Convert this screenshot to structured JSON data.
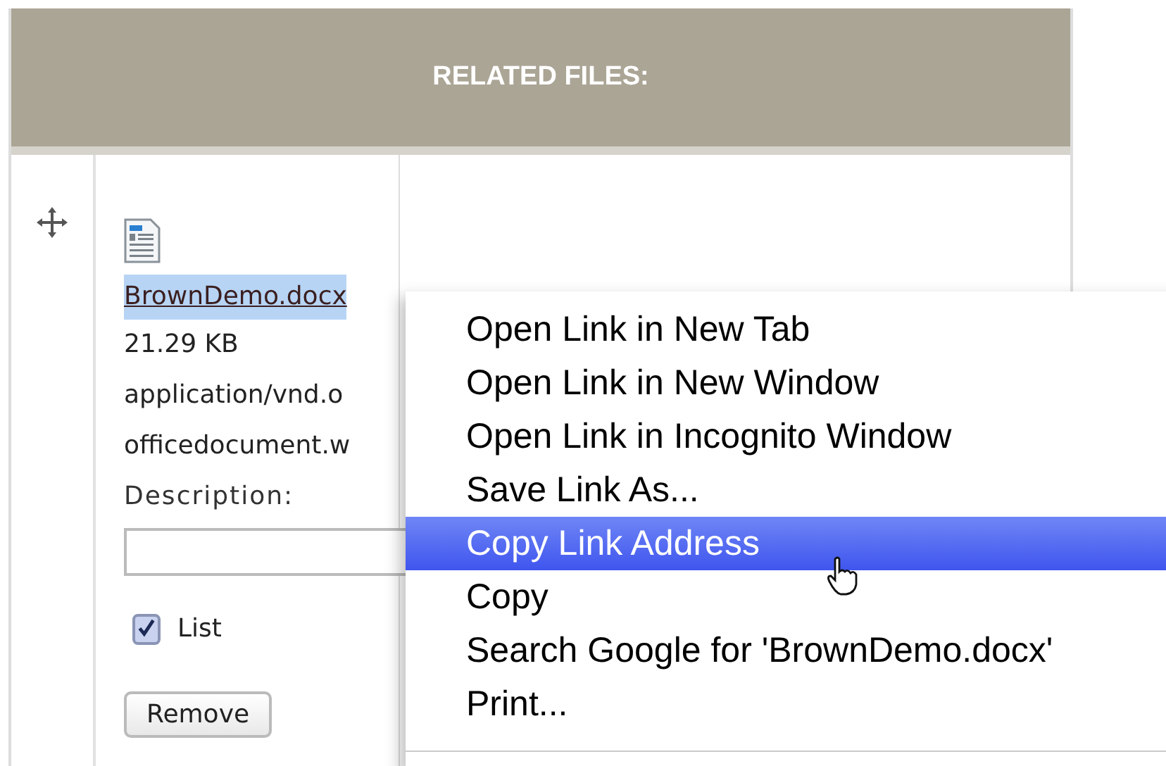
{
  "panel": {
    "title": "RELATED FILES:"
  },
  "file": {
    "name": "BrownDemo.docx",
    "size": "21.29 KB",
    "mime_lines": [
      "application/vnd.o",
      "officedocument.w"
    ],
    "description_label": "Description:",
    "list_checkbox": {
      "label": "List",
      "checked": true
    },
    "remove_button": "Remove"
  },
  "context_menu": {
    "items": [
      {
        "label": "Open Link in New Tab",
        "selected": false
      },
      {
        "label": "Open Link in New Window",
        "selected": false
      },
      {
        "label": "Open Link in Incognito Window",
        "selected": false
      },
      {
        "label": "Save Link As...",
        "selected": false
      },
      {
        "label": "Copy Link Address",
        "selected": true
      },
      {
        "label": "Copy",
        "selected": false
      },
      {
        "label": "Search Google for 'BrownDemo.docx'",
        "selected": false
      },
      {
        "label": "Print...",
        "selected": false
      }
    ]
  }
}
